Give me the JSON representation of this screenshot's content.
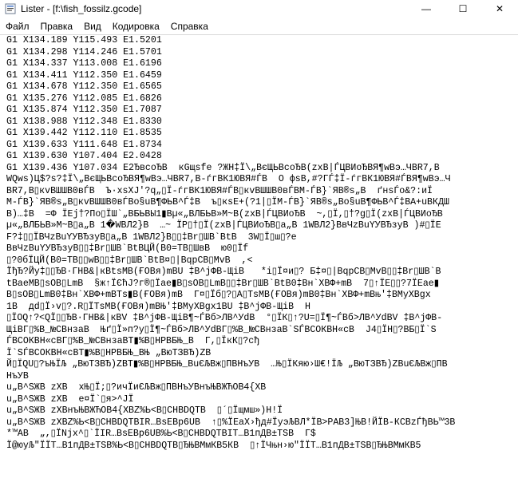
{
  "window": {
    "title": "Lister - [f:\\fish_fossilz.gcode]",
    "minimize_icon": "—",
    "maximize_icon": "☐",
    "close_icon": "✕"
  },
  "menu": [
    {
      "label": "Файл"
    },
    {
      "label": "Правка"
    },
    {
      "label": "Вид"
    },
    {
      "label": "Кодировка"
    },
    {
      "label": "Справка"
    }
  ],
  "content": {
    "lines": [
      "G1 X134.189 Y115.493 E1.5201",
      "G1 X134.298 Y114.246 E1.5701",
      "G1 X134.337 Y113.008 E1.6196",
      "G1 X134.411 Y112.350 E1.6459",
      "G1 X134.678 Y112.350 E1.6565",
      "G1 X135.276 Y112.085 E1.6826",
      "G1 X135.874 Y112.350 E1.7087",
      "G1 X138.988 Y112.348 E1.8330",
      "G1 X139.442 Y112.110 E1.8535",
      "G1 X139.633 Y111.648 E1.8734",
      "G1 X139.630 Y107.404 E2.0428",
      "G1 X139.436 Y107.034 E2ЂвсоЂВ  кGщsfe ?ЖН‡Ї\\„ВєЩЬВсоЂВ(zxВ|ЃЦВИоЂВЯ¶wВэ…ЧВR7,В",
      "WQws)Ц$?s?‡Ї\\„ВєЩЬВсоЂВЯ¶wВэ…ЧВR7,В-ѓгВК1ЮВЯ#ЃВ  О фsВ,#?ГЃ‡Ї-ѓгВК1ЮВЯ#ЃВЯ¶wВэ…Ч",
      "BR7,В▯кvВШШВ0вЃВ  Ъ·хsХJ'?q„▯Ї-ѓгВК1ЮВЯ#ЃВ▯кvВШШВ0вЃВМ-ЃВ}`ЯВ®s„В  ґнsЃо&?:иЇ",
      "М-ЃВ}`ЯВ®s„В▯кvВШШВ0вЃВо§uВ¶ФЬВ^Ѓ‡В  ъ▯кsЕ+(?1|▯ЇМ-ЃВ}`ЯВ®s„Во§uВ¶ФЬВ^Ѓ‡ВА+uВКДШ",
      "В)…‡В  =Ф ЇЕj†?По▯ЇШ`„ВБЬВЫ1▮Вµ«„ВЛБЬВ»М~В(zxВ|ЃЦВИоЂВ  ~,▯Ї,▯†?g▯Ї(zxВ|ЃЦВИоЂВ",
      "µ«„ВЛБЬВ»М~В▯а„В 1�WВЛ2}В  …~ ЇР▯†▯Ї(zxВ|ЃЦВИоЂВ▯а„В 1WВЛ2}ВвЧzВuYУВЂзуВ )#▯ЇЕ",
      "F?‡▯▯ЇВЧzВuYУВЂзуВ▯а„В 1WВЛ2}В▯▯‡Вr▯ШВ`ВtВ  3W▯Ї▯ш▯?е",
      "ВвЧzВuYУВЂзуВ▯▯‡Вr▯ШВ`ВtВЦЙ(В0=ТВ▯ШвВ  ю0▯Їf",
      "▯?0бЇЦЙ(В0=ТВ▯▯wВ▯▯‡Вr▯ШВ`ВtВ¤▯|ВqрСВ▯МvВ  ,<",
      "ЇђЂ?Йу‡▯▯ЂВ·ГНВ&|кВtsМВ(ҒОВя)mВU ‡В^jФВ-ЩiВ   *i▯Ї¤и▯? Б‡¤▯|ВqрСВ▯МvВ▯▯‡Вr▯ШВ`В",
      "tВaeМВ▯sОВ▯LmВ  §ж↑ЇЄћЈ?г®▯Їае▮В▯sОВ▯LmВ▯▯‡Вr▯ШВ`ВtВ0‡Вн`ХВФ+mВ  7▯↑ЇЕ▯▯?7ЇЕае▮",
      "В▯sОВ▯LmВ0‡Вн`ХВФ+mВТs▮В(ҒОВя)mВ  Г¤▯Їб▯?▯А▯ТsМВ(ҒОВя)mВ0‡Вн`ХВФ+mВњ'‡ВМуХВgх",
      "1В  дd▯Ї›v▯?.R▯ЇТsМВ(ҒОВя)mВЊ'‡ВМуХВgх1ВU ‡В^jФВ-ЩiВ  Н",
      "▯ЇОQ↑?<QЇ▯▯ЂВ·ГНВ&|кВV ‡В^jФВ-ЩiВ¶~ЃВб>ЛВ^УdВ  °▯ЇК▯↑?U=▯Ї¶~ЃВб>ЛВ^УdВV ‡В^jФВ-",
      "ЩiВГ▯%В_№СВнзаВ  Њґ▯Ї»п?у▯Ї¶~ЃВб>ЛВ^УdВГ▯%В_№СВнзаВ`SЃВСОКВН«сВ  J4▯ЇН▯?ВБ▯Ї`S",
      "ЃВСОКВН«сВГ▯%В_№СВнзаВТ▮%В▯НРВБЊ_В  Г,▯ЇкК▯?сђ",
      "Ї`SЃВСОКВН«сВТ▮%В▯НРВБЊ_ВЊ „ВюТЗВЂ)ZВ",
      "Й▯ЇQU▯?ъЊЇЉ „ВюТЗВЂ)ZВТ▮%В▯НРВБЊ_ВuЄЉВж▯ПВНъУВ  …Њ▯ЇКяю›Ш€!ЇЉ „ВюТЗВЂ)ZВuЄЉВж▯ПВ",
      "НъУВ",
      "u„В^SЖВ zXВ  хЊ▯Ї;▯?ичЇиЄЉВж▯ПВНъУВнъЊВЖЋОВ4{ХВ",
      "u„В^SЖВ zXВ  е¤Ї`▯я>^JЇ",
      "u„В^SЖВ zXВнъЊВЖЋОВ4{ХВZ%Ь<В▯СНВDQТВ  ▯´▯Їщмш»)Н!Ї",
      "u„В^SЖВ zXВZ%Ь<В▯СНВDQТВІR…ВsЕВр6UВ  ↑▯%ЇЕаХ›ђд#ЇуэЉВЛ*ЇВ>РАВ3]ЊВ!ЙЇВ-КСВzЃђВЬ™3В",
      "*™АВ  „,▯ЇNjх^▯`ЇІR…ВsЕВр6UВ%Ь<В▯СНВDQТВІТ…В1пДВ±ТSВ  Г$",
      "Ї@юуЉ\"ЇЇТ…В1пДВ±ТSВ%Ь<В▯СНВDQТВ▯ЂЊВМмКВ5КВ  ▯↑ЇЧњн›ю\"ЇЇТ…В1пДВ±ТSВ▯ЂЊВМмКВ5"
    ]
  }
}
